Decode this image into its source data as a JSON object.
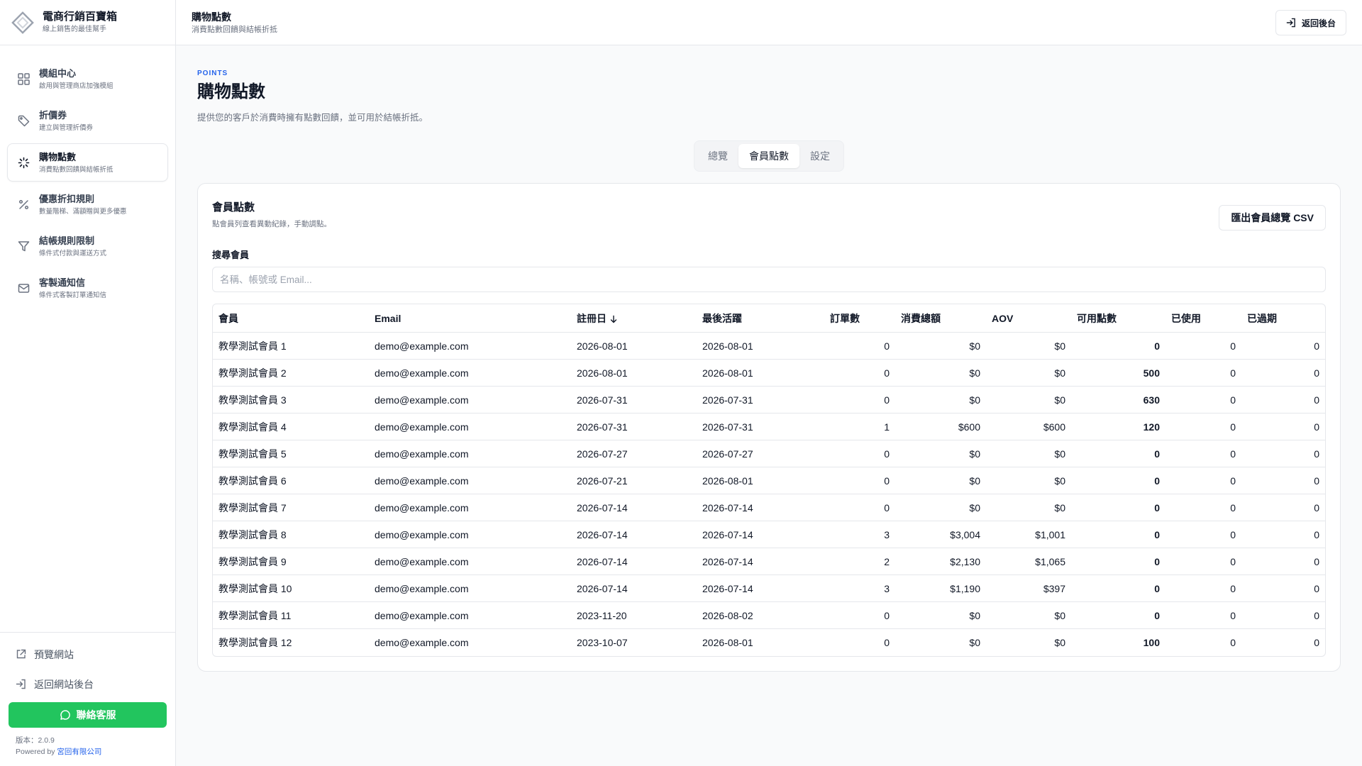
{
  "brand": {
    "title": "電商行銷百寶箱",
    "subtitle": "線上銷售的最佳幫手"
  },
  "sidebar": {
    "items": [
      {
        "label": "模組中心",
        "desc": "啟用與管理商店加強模組",
        "icon": "grid-icon"
      },
      {
        "label": "折價券",
        "desc": "建立與管理折價券",
        "icon": "tag-icon"
      },
      {
        "label": "購物點數",
        "desc": "消費點數回饋與結帳折抵",
        "icon": "sparkle-icon"
      },
      {
        "label": "優惠折扣規則",
        "desc": "數量階梯、滿額贈與更多優惠",
        "icon": "percent-icon"
      },
      {
        "label": "結帳規則限制",
        "desc": "條件式付款與運送方式",
        "icon": "filter-icon"
      },
      {
        "label": "客製通知信",
        "desc": "條件式客製訂單通知信",
        "icon": "mail-icon"
      }
    ],
    "active_index": 2,
    "bottom": {
      "preview_label": "預覽網站",
      "back_label": "返回網站後台",
      "contact_label": "聯絡客服",
      "version": "版本：2.0.9",
      "powered_prefix": "Powered by",
      "powered_company": "宮回有限公司"
    }
  },
  "topbar": {
    "title": "購物點數",
    "subtitle": "消費點數回饋與結帳折抵",
    "back_label": "返回後台"
  },
  "page": {
    "eyebrow": "POINTS",
    "title": "購物點數",
    "description": "提供您的客戶於消費時擁有點數回饋，並可用於結帳折抵。"
  },
  "tabs": [
    {
      "label": "總覽",
      "active": false
    },
    {
      "label": "會員點數",
      "active": true
    },
    {
      "label": "設定",
      "active": false
    }
  ],
  "card": {
    "title": "會員點數",
    "subtitle": "點會員列查看異動紀錄，手動調點。",
    "export_label": "匯出會員總覽 CSV",
    "search_label": "搜尋會員",
    "search_placeholder": "名稱、帳號或 Email...",
    "search_value": ""
  },
  "table": {
    "headers": {
      "member": "會員",
      "email": "Email",
      "registered": "註冊日",
      "last_active": "最後活躍",
      "orders": "訂單數",
      "total_spent": "消費總額",
      "aov": "AOV",
      "available": "可用點數",
      "used": "已使用",
      "expired": "已過期"
    },
    "sort_column": "registered",
    "sort_direction": "desc",
    "rows": [
      {
        "member": "教學測試會員 1",
        "email": "demo@example.com",
        "registered": "2026-08-01",
        "last_active": "2026-08-01",
        "orders": "0",
        "total_spent": "$0",
        "aov": "$0",
        "available": "0",
        "used": "0",
        "expired": "0"
      },
      {
        "member": "教學測試會員 2",
        "email": "demo@example.com",
        "registered": "2026-08-01",
        "last_active": "2026-08-01",
        "orders": "0",
        "total_spent": "$0",
        "aov": "$0",
        "available": "500",
        "used": "0",
        "expired": "0"
      },
      {
        "member": "教學測試會員 3",
        "email": "demo@example.com",
        "registered": "2026-07-31",
        "last_active": "2026-07-31",
        "orders": "0",
        "total_spent": "$0",
        "aov": "$0",
        "available": "630",
        "used": "0",
        "expired": "0"
      },
      {
        "member": "教學測試會員 4",
        "email": "demo@example.com",
        "registered": "2026-07-31",
        "last_active": "2026-07-31",
        "orders": "1",
        "total_spent": "$600",
        "aov": "$600",
        "available": "120",
        "used": "0",
        "expired": "0"
      },
      {
        "member": "教學測試會員 5",
        "email": "demo@example.com",
        "registered": "2026-07-27",
        "last_active": "2026-07-27",
        "orders": "0",
        "total_spent": "$0",
        "aov": "$0",
        "available": "0",
        "used": "0",
        "expired": "0"
      },
      {
        "member": "教學測試會員 6",
        "email": "demo@example.com",
        "registered": "2026-07-21",
        "last_active": "2026-08-01",
        "orders": "0",
        "total_spent": "$0",
        "aov": "$0",
        "available": "0",
        "used": "0",
        "expired": "0"
      },
      {
        "member": "教學測試會員 7",
        "email": "demo@example.com",
        "registered": "2026-07-14",
        "last_active": "2026-07-14",
        "orders": "0",
        "total_spent": "$0",
        "aov": "$0",
        "available": "0",
        "used": "0",
        "expired": "0"
      },
      {
        "member": "教學測試會員 8",
        "email": "demo@example.com",
        "registered": "2026-07-14",
        "last_active": "2026-07-14",
        "orders": "3",
        "total_spent": "$3,004",
        "aov": "$1,001",
        "available": "0",
        "used": "0",
        "expired": "0"
      },
      {
        "member": "教學測試會員 9",
        "email": "demo@example.com",
        "registered": "2026-07-14",
        "last_active": "2026-07-14",
        "orders": "2",
        "total_spent": "$2,130",
        "aov": "$1,065",
        "available": "0",
        "used": "0",
        "expired": "0"
      },
      {
        "member": "教學測試會員 10",
        "email": "demo@example.com",
        "registered": "2026-07-14",
        "last_active": "2026-07-14",
        "orders": "3",
        "total_spent": "$1,190",
        "aov": "$397",
        "available": "0",
        "used": "0",
        "expired": "0"
      },
      {
        "member": "教學測試會員 11",
        "email": "demo@example.com",
        "registered": "2023-11-20",
        "last_active": "2026-08-02",
        "orders": "0",
        "total_spent": "$0",
        "aov": "$0",
        "available": "0",
        "used": "0",
        "expired": "0"
      },
      {
        "member": "教學測試會員 12",
        "email": "demo@example.com",
        "registered": "2023-10-07",
        "last_active": "2026-08-01",
        "orders": "0",
        "total_spent": "$0",
        "aov": "$0",
        "available": "100",
        "used": "0",
        "expired": "0"
      }
    ]
  },
  "colors": {
    "accent_blue": "#2563eb",
    "contact_green": "#22c55e",
    "border": "#e5e7eb",
    "muted_text": "#6b7280"
  }
}
